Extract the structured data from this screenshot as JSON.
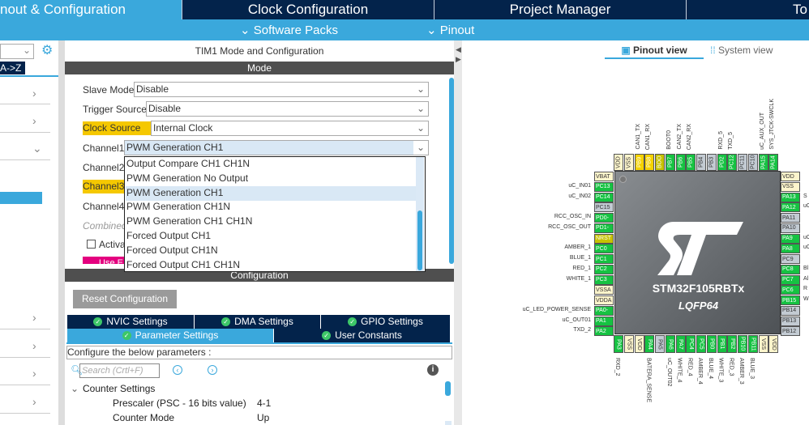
{
  "tabs": [
    "nout & Configuration",
    "Clock Configuration",
    "Project Manager",
    "To"
  ],
  "subbar": {
    "software_packs": "Software Packs",
    "pinout": "Pinout"
  },
  "sidebar": {
    "sort": "A->Z"
  },
  "mode_panel": {
    "title": "TIM1 Mode and Configuration",
    "mode_header": "Mode",
    "fields": [
      {
        "label": "Slave Mode",
        "value": "Disable"
      },
      {
        "label": "Trigger Source",
        "value": "Disable"
      },
      {
        "label": "Clock Source",
        "value": "Internal Clock"
      },
      {
        "label": "Channel1",
        "value": "PWM Generation CH1"
      }
    ],
    "labels_behind": [
      "Channel2",
      "Channel3",
      "Channel4",
      "Combined",
      "Activa",
      "Use E"
    ],
    "dropdown_options": [
      "Output Compare CH1 CH1N",
      "PWM Generation No Output",
      "PWM Generation CH1",
      "PWM Generation CH1N",
      "PWM Generation CH1 CH1N",
      "Forced Output CH1",
      "Forced Output CH1N",
      "Forced Output CH1 CH1N"
    ],
    "selected_option": "PWM Generation CH1"
  },
  "config_panel": {
    "header": "Configuration",
    "reset_label": "Reset Configuration",
    "tabs_row1": [
      "NVIC Settings",
      "DMA Settings",
      "GPIO Settings"
    ],
    "tabs_row2": [
      "Parameter Settings",
      "User Constants"
    ],
    "instruction": "Configure the below parameters :",
    "search_placeholder": "Search (Crtl+F)",
    "group": "Counter Settings",
    "params": [
      {
        "name": "Prescaler (PSC - 16 bits value)",
        "value": "4-1"
      },
      {
        "name": "Counter Mode",
        "value": "Up"
      }
    ]
  },
  "view_tabs": {
    "pinout": "Pinout view",
    "system": "System view"
  },
  "chip": {
    "name": "STM32F105RBTx",
    "package": "LQFP64",
    "colors": {
      "green": "#16c242",
      "grey": "#c3cbd3",
      "power": "#fdf5cc",
      "yellow": "#f5d200",
      "olive": "#c7c200"
    },
    "top": [
      [
        "VDD",
        "power",
        ""
      ],
      [
        "VSS",
        "power",
        ""
      ],
      [
        "PB9",
        "yellow",
        "CAN1_TX"
      ],
      [
        "PB8",
        "yellow",
        "CAN1_RX"
      ],
      [
        "BOO",
        "olive",
        ""
      ],
      [
        "PB7",
        "green",
        "BOOT0"
      ],
      [
        "PB6",
        "green",
        "CAN2_TX"
      ],
      [
        "PB5",
        "green",
        "CAN2_RX"
      ],
      [
        "PB4",
        "grey",
        ""
      ],
      [
        "PB3",
        "grey",
        ""
      ],
      [
        "PD2",
        "green",
        "RXD_5"
      ],
      [
        "PC12",
        "green",
        "TXD_5"
      ],
      [
        "PC11",
        "grey",
        ""
      ],
      [
        "PC10",
        "grey",
        ""
      ],
      [
        "PA15",
        "green",
        "uC_AUX_OUT"
      ],
      [
        "PA14",
        "green",
        "SYS_JTCK-SWCLK"
      ]
    ],
    "left": [
      [
        "VBAT",
        "power",
        ""
      ],
      [
        "PC13",
        "green",
        "uC_IN01"
      ],
      [
        "PC14",
        "green",
        "uC_IN02"
      ],
      [
        "PC15",
        "grey",
        ""
      ],
      [
        "PD0-",
        "green",
        "RCC_OSC_IN"
      ],
      [
        "PD1-",
        "green",
        "RCC_OSC_OUT"
      ],
      [
        "NRST",
        "olive",
        ""
      ],
      [
        "PC0",
        "green",
        "AMBER_1"
      ],
      [
        "PC1",
        "green",
        "BLUE_1"
      ],
      [
        "PC2",
        "green",
        "RED_1"
      ],
      [
        "PC3",
        "green",
        "WHITE_1"
      ],
      [
        "VSSA",
        "power",
        ""
      ],
      [
        "VDDA",
        "power",
        ""
      ],
      [
        "PA0-",
        "green",
        "uC_LED_POWER_SENSE"
      ],
      [
        "PA1",
        "green",
        "uC_OUT01"
      ],
      [
        "PA2",
        "green",
        "TXD_2"
      ]
    ],
    "right": [
      [
        "VDD",
        "power",
        ""
      ],
      [
        "VSS",
        "power",
        ""
      ],
      [
        "PA13",
        "green",
        "S"
      ],
      [
        "PA12",
        "green",
        "uC"
      ],
      [
        "PA11",
        "grey",
        ""
      ],
      [
        "PA10",
        "grey",
        ""
      ],
      [
        "PA9",
        "green",
        "uC"
      ],
      [
        "PA8",
        "green",
        "uC"
      ],
      [
        "PC9",
        "grey",
        ""
      ],
      [
        "PC8",
        "green",
        "Bl"
      ],
      [
        "PC7",
        "green",
        "Al"
      ],
      [
        "PC6",
        "green",
        "R"
      ],
      [
        "PB15",
        "green",
        "W"
      ],
      [
        "PB14",
        "grey",
        ""
      ],
      [
        "PB13",
        "grey",
        ""
      ],
      [
        "PB12",
        "grey",
        ""
      ]
    ],
    "bottom": [
      [
        "PA3",
        "green",
        "RXD_2"
      ],
      [
        "VSS",
        "power",
        ""
      ],
      [
        "VDD",
        "power",
        ""
      ],
      [
        "PA4",
        "green",
        "BATERA_SENSE"
      ],
      [
        "PA5",
        "grey",
        ""
      ],
      [
        "PA6",
        "green",
        "uC_OUT02"
      ],
      [
        "PA7",
        "green",
        "WHITE_4"
      ],
      [
        "PC4",
        "green",
        "RED_4"
      ],
      [
        "PC5",
        "green",
        "AMBER_4"
      ],
      [
        "PB0",
        "green",
        "BLUE_4"
      ],
      [
        "PB1",
        "green",
        "WHITE_3"
      ],
      [
        "PB2",
        "green",
        "RED_3"
      ],
      [
        "PB10",
        "green",
        "AMBER_3"
      ],
      [
        "PB11",
        "green",
        "BLUE_3"
      ],
      [
        "VSS",
        "power",
        ""
      ],
      [
        "VDD",
        "power",
        ""
      ]
    ]
  }
}
